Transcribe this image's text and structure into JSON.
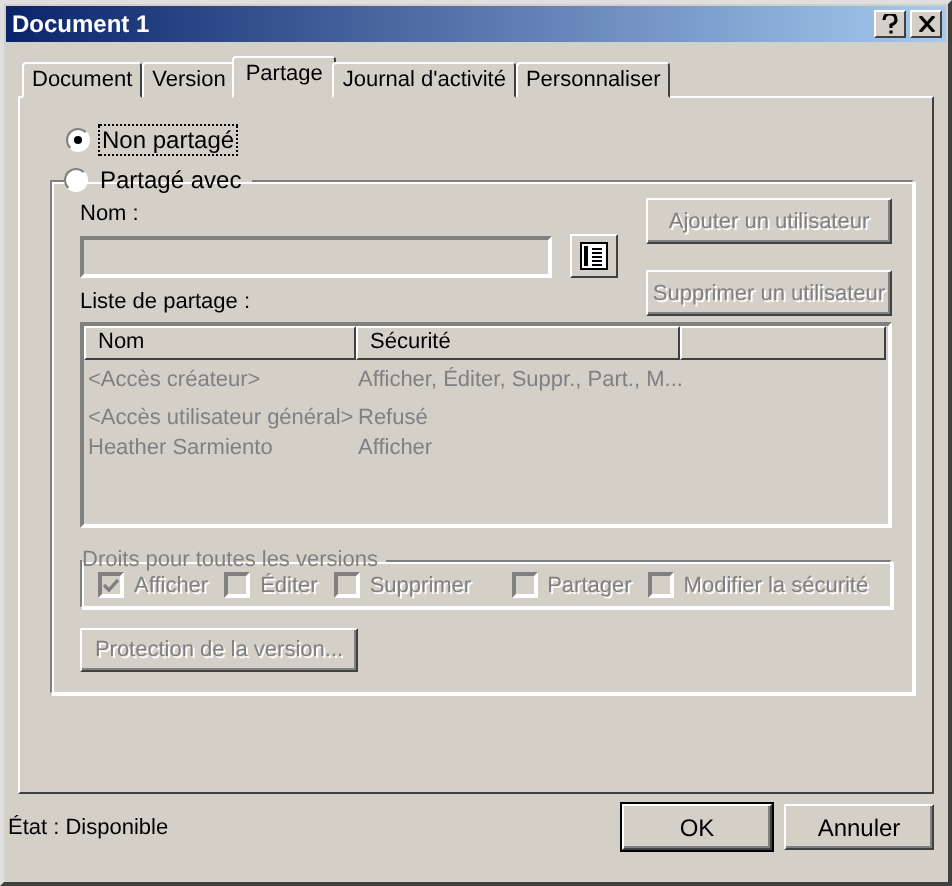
{
  "window": {
    "title": "Document 1"
  },
  "tabs": [
    {
      "label": "Document",
      "selected": false
    },
    {
      "label": "Version",
      "selected": false
    },
    {
      "label": "Partage",
      "selected": true
    },
    {
      "label": "Journal d'activité",
      "selected": false
    },
    {
      "label": "Personnaliser",
      "selected": false
    }
  ],
  "sharing": {
    "not_shared": {
      "label": "Non partagé",
      "selected": true
    },
    "shared_with": {
      "label": "Partagé avec",
      "selected": false
    },
    "name_label": "Nom :",
    "name_field": {
      "disabled": true
    },
    "add_button": {
      "label": "Ajouter un utilisateur",
      "disabled": true
    },
    "remove_button": {
      "label": "Supprimer un utilisateur",
      "disabled": true
    },
    "list_label": "Liste de partage :",
    "list": {
      "columns": [
        "Nom",
        "Sécurité"
      ],
      "rows": [
        {
          "name": "<Accès créateur>",
          "security": "Afficher, Éditer, Suppr., Part., M..."
        },
        {
          "name": "<Accès utilisateur général>",
          "security": "Refusé"
        },
        {
          "name": "Heather Sarmiento",
          "security": "Afficher"
        }
      ]
    },
    "rights": {
      "title": "Droits pour toutes les versions",
      "options": [
        {
          "label": "Afficher",
          "checked": true,
          "disabled": true
        },
        {
          "label": "Éditer",
          "checked": false,
          "disabled": true
        },
        {
          "label": "Supprimer",
          "checked": false,
          "disabled": true
        },
        {
          "label": "Partager",
          "checked": false,
          "disabled": true
        },
        {
          "label": "Modifier la sécurité",
          "checked": false,
          "disabled": true
        }
      ]
    },
    "protection_button": {
      "label": "Protection de la version...",
      "disabled": true
    }
  },
  "status": "État : Disponible",
  "buttons": [
    {
      "label": "OK",
      "kind": "default"
    },
    {
      "label": "Annuler",
      "kind": "normal"
    }
  ]
}
